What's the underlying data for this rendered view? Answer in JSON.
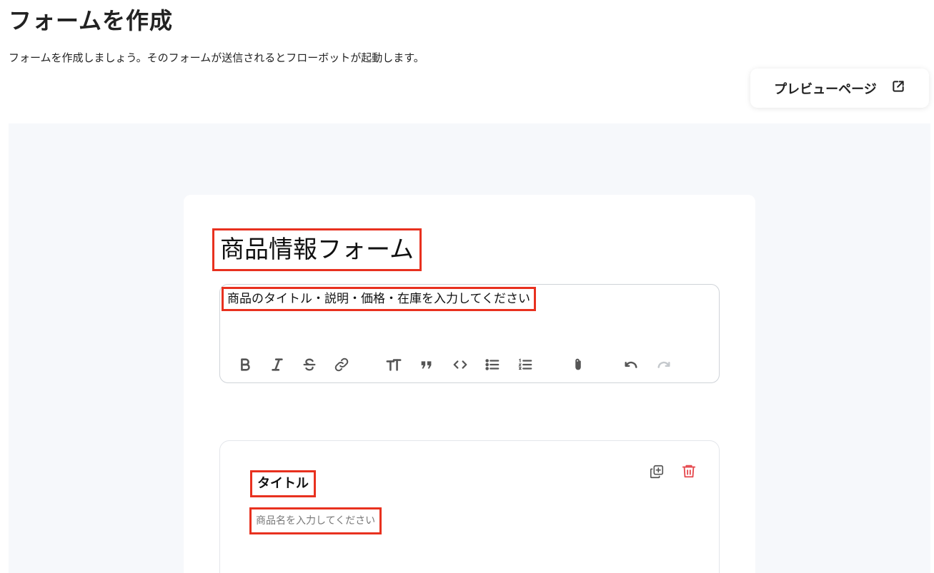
{
  "header": {
    "title": "フォームを作成",
    "description": "フォームを作成しましょう。そのフォームが送信されるとフローボットが起動します。"
  },
  "preview_button": {
    "label": "プレビューページ",
    "icon": "external-link-icon"
  },
  "form": {
    "title": "商品情報フォーム",
    "description": "商品のタイトル・説明・価格・在庫を入力してください",
    "toolbar": [
      {
        "name": "bold-icon"
      },
      {
        "name": "italic-icon"
      },
      {
        "name": "strikethrough-icon"
      },
      {
        "name": "link-icon"
      },
      {
        "name": "heading-icon"
      },
      {
        "name": "quote-icon"
      },
      {
        "name": "code-icon"
      },
      {
        "name": "bullet-list-icon"
      },
      {
        "name": "numbered-list-icon"
      },
      {
        "name": "attachment-icon"
      },
      {
        "name": "undo-icon"
      },
      {
        "name": "redo-icon"
      }
    ]
  },
  "field": {
    "label": "タイトル",
    "placeholder": "商品名を入力してください",
    "actions": [
      "duplicate-icon",
      "delete-icon"
    ]
  },
  "colors": {
    "highlight": "#e8311f",
    "delete": "#e5484d",
    "canvas": "#f6f8fb"
  }
}
